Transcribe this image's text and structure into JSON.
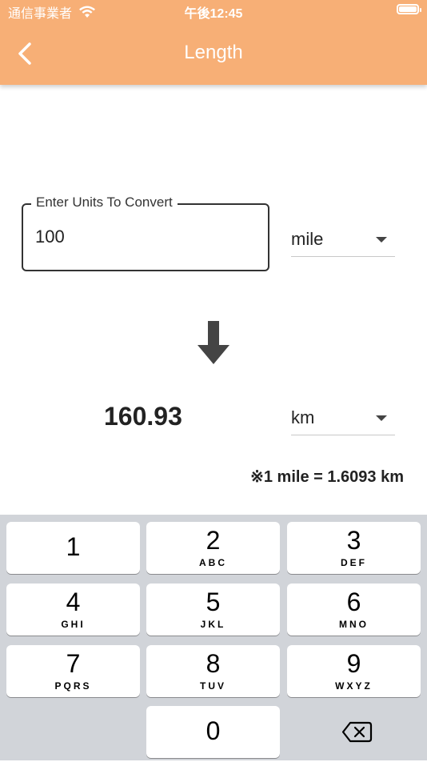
{
  "status_bar": {
    "carrier": "通信事業者",
    "time": "午後12:45"
  },
  "app_bar": {
    "title": "Length"
  },
  "input": {
    "label": "Enter Units To Convert",
    "value": "100"
  },
  "from_unit": {
    "selected": "mile"
  },
  "to_unit": {
    "selected": "km"
  },
  "result": "160.93",
  "conversion_note": "※1 mile = 1.6093 km",
  "keypad": {
    "keys": [
      {
        "num": "1",
        "letters": ""
      },
      {
        "num": "2",
        "letters": "ABC"
      },
      {
        "num": "3",
        "letters": "DEF"
      },
      {
        "num": "4",
        "letters": "GHI"
      },
      {
        "num": "5",
        "letters": "JKL"
      },
      {
        "num": "6",
        "letters": "MNO"
      },
      {
        "num": "7",
        "letters": "PQRS"
      },
      {
        "num": "8",
        "letters": "TUV"
      },
      {
        "num": "9",
        "letters": "WXYZ"
      },
      {
        "num": "0",
        "letters": ""
      }
    ]
  },
  "colors": {
    "app_bar": "#F7AF76",
    "keypad_bg": "#D1D4D9"
  },
  "icons": {
    "back": "chevron-left-icon",
    "arrow": "arrow-down-icon",
    "delete": "backspace-icon"
  }
}
